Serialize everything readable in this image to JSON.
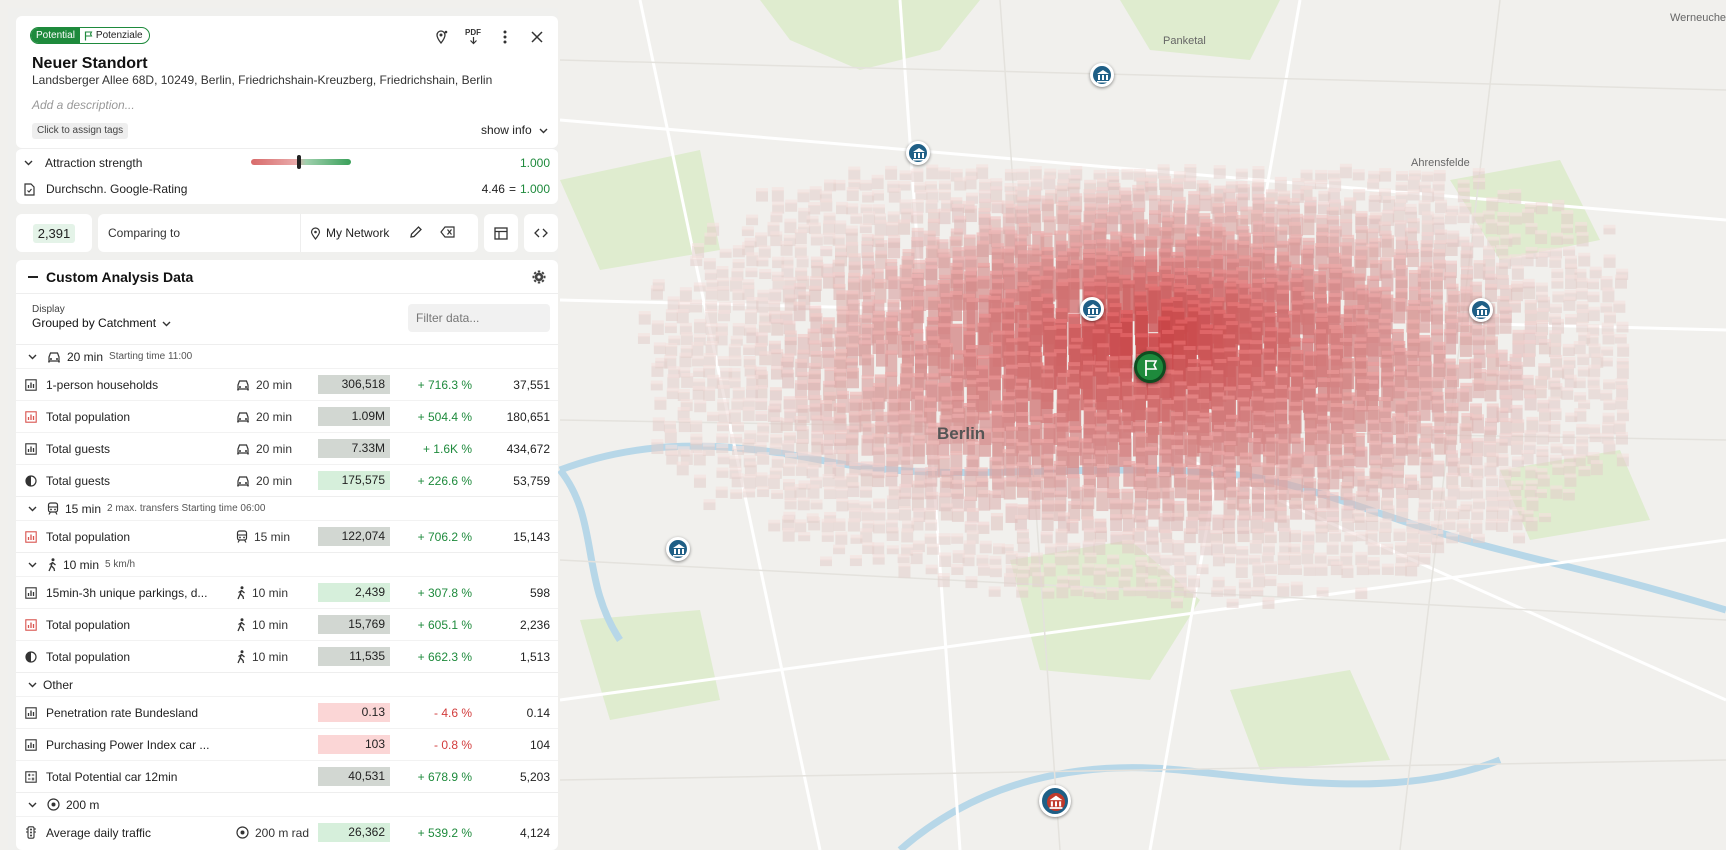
{
  "header": {
    "badge_primary": "Potential",
    "badge_secondary": "Potenziale",
    "pdf_label": "PDF",
    "title": "Neuer Standort",
    "address": "Landsberger Allee 68D, 10249, Berlin, Friedrichshain-Kreuzberg, Friedrichshain, Berlin",
    "description_placeholder": "Add a description...",
    "tags_label": "Click to assign tags",
    "show_info_label": "show info"
  },
  "attraction": {
    "label": "Attraction strength",
    "value": "1.000",
    "rating_label": "Durchschn. Google-Rating",
    "rating_value": "4.46",
    "rating_eq": "=",
    "rating_score": "1.000"
  },
  "compare": {
    "count": "2,391",
    "label": "Comparing to",
    "network": "My Network"
  },
  "analysis": {
    "title": "Custom Analysis Data",
    "display_label": "Display",
    "display_value": "Grouped by Catchment",
    "filter_placeholder": "Filter data...",
    "groups": [
      {
        "icon": "car",
        "title": "20 min",
        "sub": "Starting time 11:00",
        "rows": [
          {
            "icon": "chart",
            "name": "1-person households",
            "mode": "20 min",
            "mode_icon": "car",
            "value": "306,518",
            "style": "gray",
            "pct": "+ 716.3 %",
            "pct_dir": "up",
            "ref": "37,551"
          },
          {
            "icon": "chart-red",
            "name": "Total population",
            "mode": "20 min",
            "mode_icon": "car",
            "value": "1.09M",
            "style": "gray",
            "pct": "+ 504.4 %",
            "pct_dir": "up",
            "ref": "180,651"
          },
          {
            "icon": "chart",
            "name": "Total guests",
            "mode": "20 min",
            "mode_icon": "car",
            "value": "7.33M",
            "style": "gray",
            "pct": "+ 1.6K %",
            "pct_dir": "up",
            "ref": "434,672"
          },
          {
            "icon": "half",
            "name": "Total guests",
            "mode": "20 min",
            "mode_icon": "car",
            "value": "175,575",
            "style": "green",
            "pct": "+ 226.6 %",
            "pct_dir": "up",
            "ref": "53,759"
          }
        ]
      },
      {
        "icon": "train",
        "title": "15 min",
        "sub": "2 max. transfers  Starting time 06:00",
        "rows": [
          {
            "icon": "chart-red",
            "name": "Total population",
            "mode": "15 min",
            "mode_icon": "train",
            "value": "122,074",
            "style": "gray",
            "pct": "+ 706.2 %",
            "pct_dir": "up",
            "ref": "15,143"
          }
        ]
      },
      {
        "icon": "walk",
        "title": "10 min",
        "sub": "5 km/h",
        "rows": [
          {
            "icon": "chart",
            "name": "15min-3h unique parkings, d...",
            "mode": "10 min",
            "mode_icon": "walk",
            "value": "2,439",
            "style": "green",
            "pct": "+ 307.8 %",
            "pct_dir": "up",
            "ref": "598"
          },
          {
            "icon": "chart-red",
            "name": "Total population",
            "mode": "10 min",
            "mode_icon": "walk",
            "value": "15,769",
            "style": "gray",
            "pct": "+ 605.1 %",
            "pct_dir": "up",
            "ref": "2,236"
          },
          {
            "icon": "half",
            "name": "Total population",
            "mode": "10 min",
            "mode_icon": "walk",
            "value": "11,535",
            "style": "gray",
            "pct": "+ 662.3 %",
            "pct_dir": "up",
            "ref": "1,513"
          }
        ]
      },
      {
        "icon": "",
        "title": "Other",
        "sub": "",
        "rows": [
          {
            "icon": "chart",
            "name": "Penetration rate Bundesland",
            "mode": "",
            "mode_icon": "",
            "value": "0.13",
            "style": "red",
            "pct": "- 4.6 %",
            "pct_dir": "down",
            "ref": "0.14"
          },
          {
            "icon": "chart",
            "name": "Purchasing Power Index car ...",
            "mode": "",
            "mode_icon": "",
            "value": "103",
            "style": "red",
            "pct": "- 0.8 %",
            "pct_dir": "down",
            "ref": "104"
          },
          {
            "icon": "calc",
            "name": "Total Potential car 12min",
            "mode": "",
            "mode_icon": "",
            "value": "40,531",
            "style": "gray",
            "pct": "+ 678.9 %",
            "pct_dir": "up",
            "ref": "5,203"
          }
        ]
      },
      {
        "icon": "radius",
        "title": "200 m",
        "sub": "",
        "rows": [
          {
            "icon": "traffic",
            "name": "Average daily traffic",
            "mode": "200 m rad",
            "mode_icon": "radius",
            "value": "26,362",
            "style": "green",
            "pct": "+ 539.2 %",
            "pct_dir": "up",
            "ref": "4,124"
          }
        ]
      }
    ]
  },
  "map": {
    "labels": {
      "berlin": "Berlin",
      "panketal": "Panketal",
      "ahrensfelde": "Ahrensfelde",
      "werneuchen": "Werneuche"
    },
    "colors": {
      "brand_green": "#1e8a3c",
      "pin_blue": "#1f5f86",
      "heat_red": "#e86a66"
    }
  }
}
